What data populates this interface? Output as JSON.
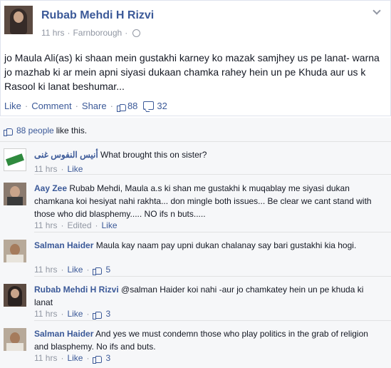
{
  "post": {
    "author": "Rubab Mehdi H Rizvi",
    "time": "11 hrs",
    "location": "Farnborough",
    "text": "jo Maula Ali(as) ki shaan mein gustakhi karney ko mazak samjhey us pe lanat- warna jo mazhab ki ar mein apni siyasi dukaan chamka rahey hein un pe Khuda aur us k Rasool ki lanat beshumar...",
    "actions": {
      "like": "Like",
      "comment": "Comment",
      "share": "Share",
      "like_count": "88",
      "comment_count": "32"
    },
    "likes_summary": {
      "count_text": "88 people",
      "suffix": "like this."
    }
  },
  "comments": [
    {
      "name": "أنيس النفوس غنى",
      "text": "What brought this on sister?",
      "time": "11 hrs",
      "like": "Like",
      "edited": "",
      "like_count": ""
    },
    {
      "name": "Aay Zee",
      "text": "Rubab Mehdi, Maula a.s ki shan me gustakhi k muqablay me siyasi dukan chamkana koi hesiyat nahi rakhta... don mingle both issues... Be clear we cant stand with those who did blasphemy..... NO ifs n buts.....",
      "time": "11 hrs",
      "like": "Like",
      "edited": "Edited",
      "like_count": ""
    },
    {
      "name": "Salman Haider",
      "text": "Maula kay naam pay upni dukan chalanay say bari gustakhi kia hogi.",
      "time": "11 hrs",
      "like": "Like",
      "edited": "",
      "like_count": "5"
    },
    {
      "name": "Rubab Mehdi H Rizvi",
      "text": "@salman Haider koi nahi -aur jo chamkatey hein un pe khuda ki lanat",
      "time": "11 hrs",
      "like": "Like",
      "edited": "",
      "like_count": "3"
    },
    {
      "name": "Salman Haider",
      "text": "And yes we must condemn those who play politics in the grab of religion and blasphemy. No ifs and buts.",
      "time": "11 hrs",
      "like": "Like",
      "edited": "",
      "like_count": "3"
    }
  ]
}
